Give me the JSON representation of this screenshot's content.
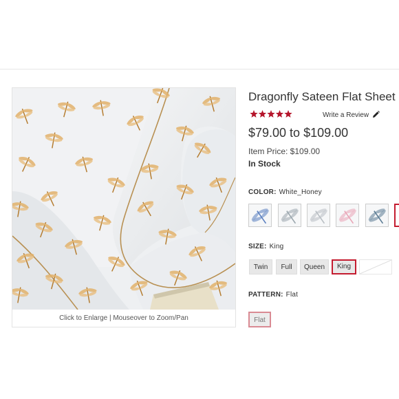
{
  "product": {
    "title": "Dragonfly Sateen Flat Sheet",
    "rating": 5,
    "rating_max": 5,
    "write_review": "Write a Review",
    "price_range": "$79.00 to $109.00",
    "item_price": "Item Price: $109.00",
    "stock": "In Stock"
  },
  "image": {
    "caption": "Click to Enlarge | Mouseover to Zoom/Pan"
  },
  "color": {
    "label": "COLOR:",
    "selected": "White_Honey",
    "swatches": [
      {
        "name": "Blue",
        "color": "#5a7fc0"
      },
      {
        "name": "Grey",
        "color": "#9aa6ad"
      },
      {
        "name": "Silver",
        "color": "#b8bec3"
      },
      {
        "name": "Pink",
        "color": "#e9a4b6"
      },
      {
        "name": "Slate",
        "color": "#5b7c94"
      },
      {
        "name": "White_Honey",
        "color": "#d9a55a"
      }
    ]
  },
  "size": {
    "label": "SIZE:",
    "selected": "King",
    "options": [
      "Twin",
      "Full",
      "Queen",
      "King"
    ]
  },
  "pattern": {
    "label": "PATTERN:",
    "selected": "Flat",
    "options": [
      "Flat"
    ]
  },
  "colors": {
    "accent": "#c41b2f",
    "star": "#b5152b",
    "honey": "#d9a55a",
    "piping": "#b89052"
  },
  "icons": {
    "review": "pencil-icon",
    "rating": "star-icon"
  }
}
